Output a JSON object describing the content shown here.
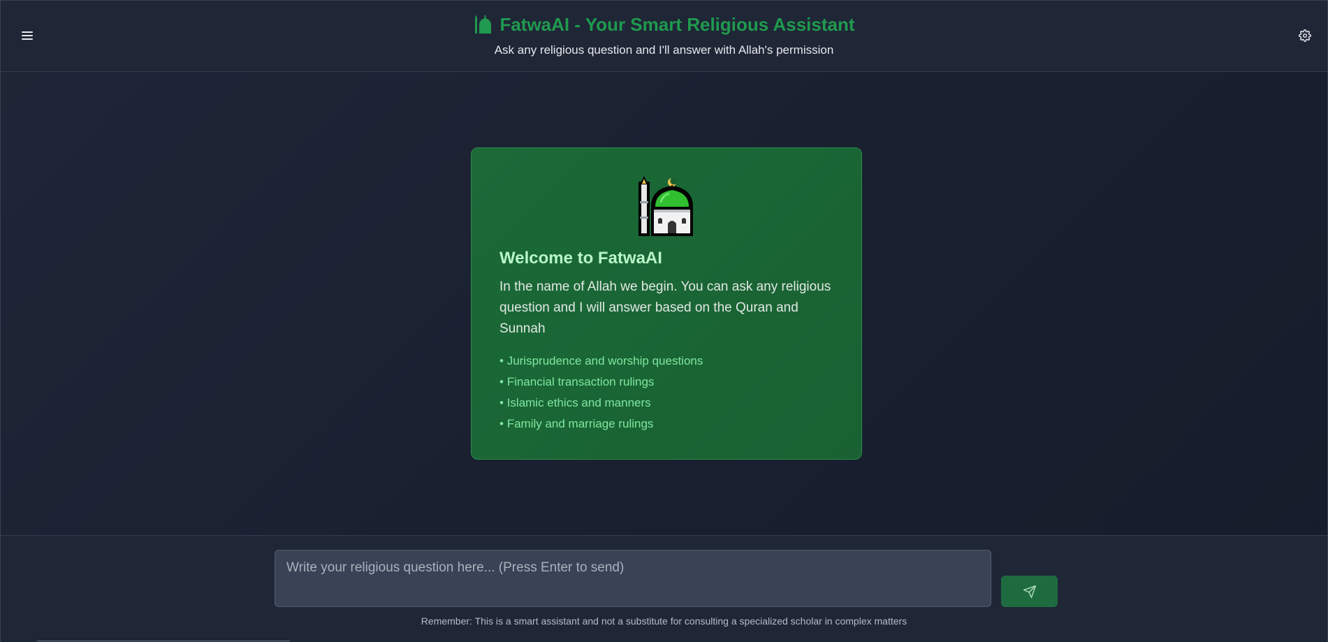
{
  "header": {
    "title": "FatwaAI - Your Smart Religious Assistant",
    "subtitle": "Ask any religious question and I'll answer with Allah's permission",
    "menu_icon": "hamburger-menu-icon",
    "settings_icon": "gear-icon",
    "brand_color": "#1f9a4e"
  },
  "welcome": {
    "icon": "mosque-icon",
    "title": "Welcome to FatwaAI",
    "text": "In the name of Allah we begin. You can ask any religious question and I will answer based on the Quran and Sunnah",
    "features": [
      "Jurisprudence and worship questions",
      "Financial transaction rulings",
      "Islamic ethics and manners",
      "Family and marriage rulings"
    ]
  },
  "composer": {
    "placeholder": "Write your religious question here... (Press Enter to send)",
    "value": "",
    "send_icon": "paper-plane-icon",
    "disclaimer": "Remember: This is a smart assistant and not a substitute for consulting a specialized scholar in complex matters"
  },
  "colors": {
    "background": "#1b2130",
    "card": "#1b6a38",
    "accent": "#1f9a4e",
    "feature_text": "#7fe8a0"
  }
}
